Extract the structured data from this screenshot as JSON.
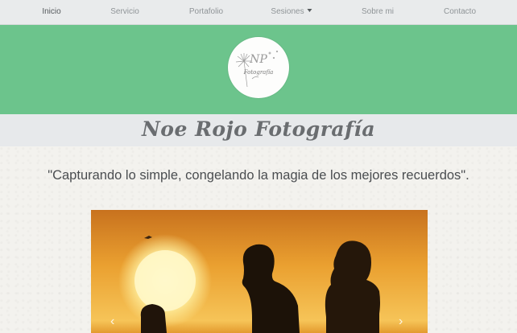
{
  "nav": {
    "items": [
      {
        "label": "Inicio",
        "active": true
      },
      {
        "label": "Servicio"
      },
      {
        "label": "Portafolio"
      },
      {
        "label": "Sesiones",
        "dropdown": true
      },
      {
        "label": "Sobre mi"
      },
      {
        "label": "Contacto"
      }
    ]
  },
  "hero": {
    "logo_monogram": "NP",
    "logo_subtext": "Fotografía",
    "bg_color": "#6cc48c"
  },
  "title": "Noe Rojo Fotografía",
  "quote": "\"Capturando lo simple, congelando la magia de los mejores recuerdos\".",
  "carousel": {
    "image": "sunset-couple-silhouette",
    "prev_icon": "chevron-left-icon",
    "next_icon": "chevron-right-icon"
  }
}
